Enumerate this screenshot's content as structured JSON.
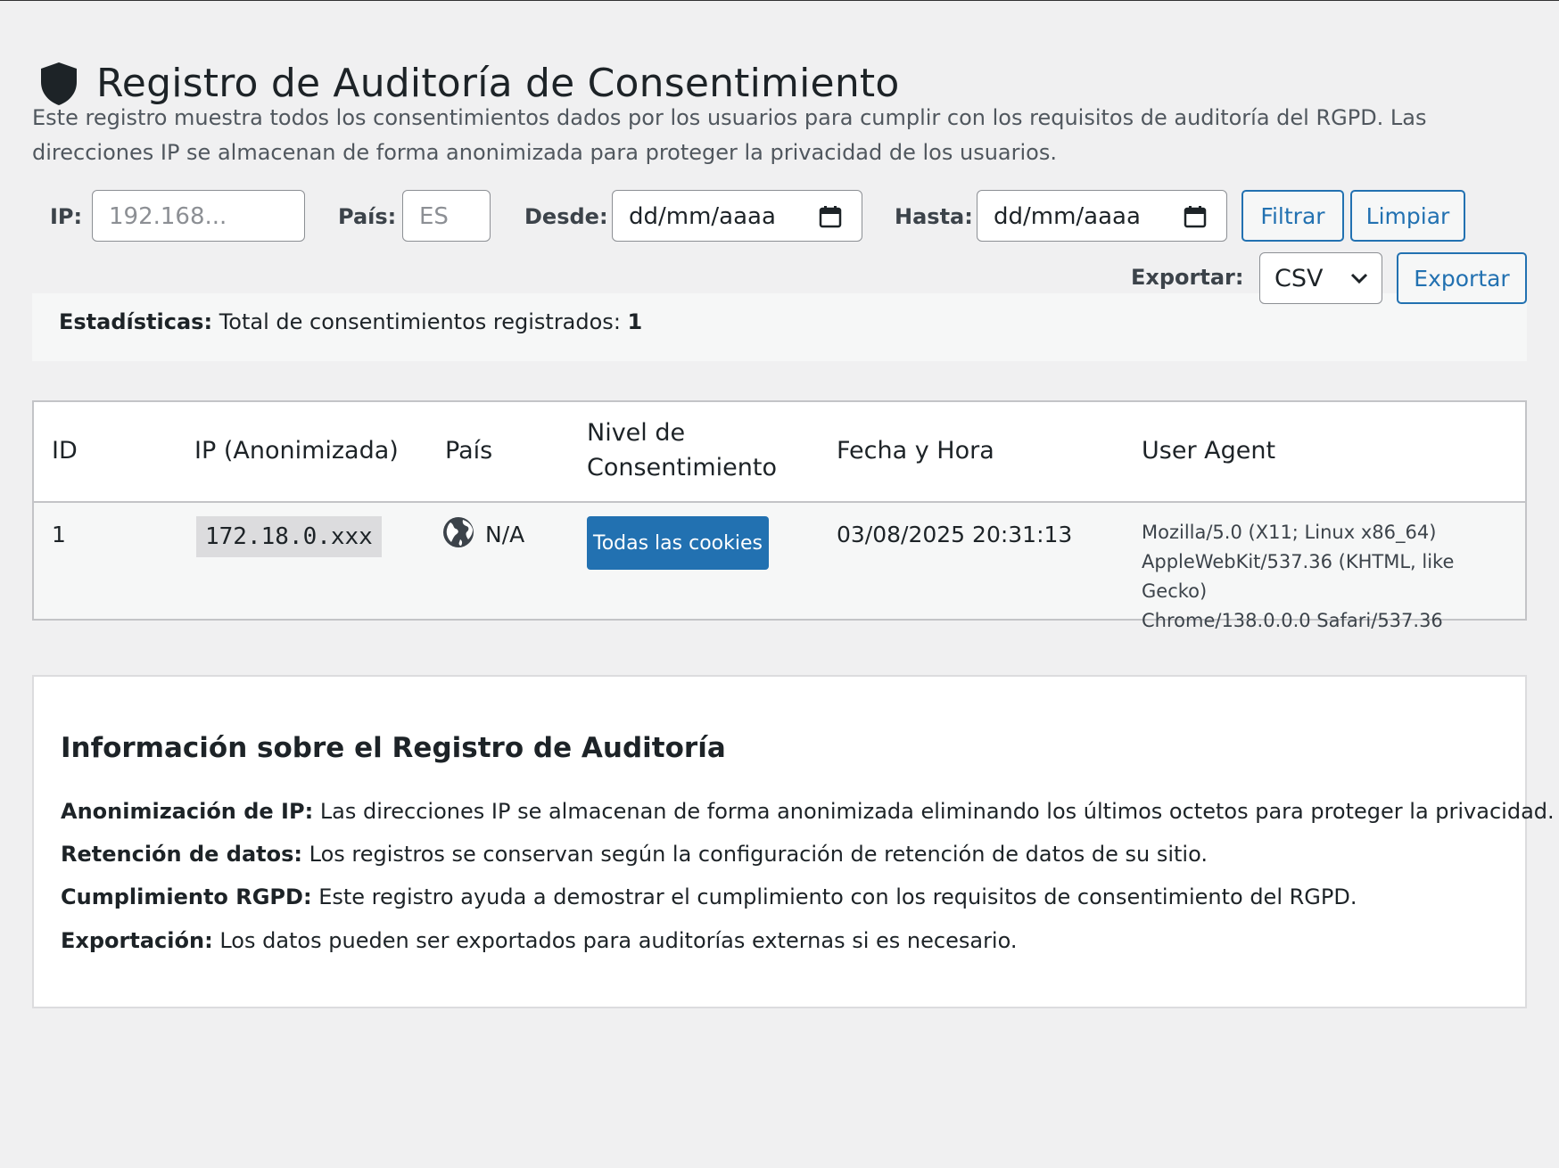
{
  "page": {
    "title": "Registro de Auditoría de Consentimiento",
    "title_icon": "shield-icon",
    "description": "Este registro muestra todos los consentimientos dados por los usuarios para cumplir con los requisitos de auditoría del RGPD. Las direcciones IP se almacenan de forma anonimizada para proteger la privacidad de los usuarios."
  },
  "filters": {
    "ip_label": "IP:",
    "ip_placeholder": "192.168...",
    "country_label": "País:",
    "country_placeholder": "ES",
    "from_label": "Desde:",
    "from_value": "dd/mm/aaaa",
    "to_label": "Hasta:",
    "to_value": "dd/mm/aaaa",
    "filter_button": "Filtrar",
    "clear_button": "Limpiar"
  },
  "export": {
    "label": "Exportar:",
    "format_selected": "CSV",
    "button": "Exportar"
  },
  "stats": {
    "label": "Estadísticas:",
    "text": "Total de consentimientos registrados:",
    "total": "1"
  },
  "table": {
    "headers": {
      "id": "ID",
      "ip": "IP (Anonimizada)",
      "country": "País",
      "level_line1": "Nivel de",
      "level_line2": "Consentimiento",
      "datetime": "Fecha y Hora",
      "user_agent": "User Agent"
    },
    "rows": [
      {
        "id": "1",
        "ip": "172.18.0.xxx",
        "country": "N/A",
        "country_icon": "globe-icon",
        "level": "Todas las cookies",
        "datetime": "03/08/2025 20:31:13",
        "user_agent_line1": "Mozilla/5.0 (X11; Linux x86_64)",
        "user_agent_line2": "AppleWebKit/537.36 (KHTML, like Gecko)",
        "user_agent_line3": "Chrome/138.0.0.0 Safari/537.36"
      }
    ]
  },
  "info": {
    "title": "Información sobre el Registro de Auditoría",
    "items": [
      {
        "label": "Anonimización de IP:",
        "text": "Las direcciones IP se almacenan de forma anonimizada eliminando los últimos octetos para proteger la privacidad."
      },
      {
        "label": "Retención de datos:",
        "text": "Los registros se conservan según la configuración de retención de datos de su sitio."
      },
      {
        "label": "Cumplimiento RGPD:",
        "text": "Este registro ayuda a demostrar el cumplimiento con los requisitos de consentimiento del RGPD."
      },
      {
        "label": "Exportación:",
        "text": "Los datos pueden ser exportados para auditorías externas si es necesario."
      }
    ]
  },
  "colors": {
    "accent": "#2271b1",
    "background": "#f0f0f1",
    "text": "#1d2327"
  }
}
